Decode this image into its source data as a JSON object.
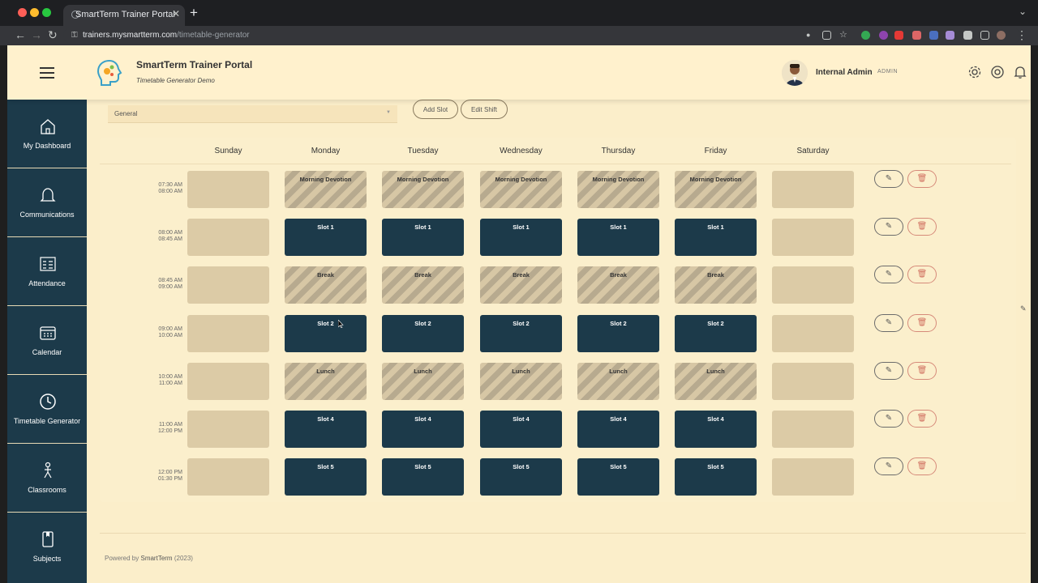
{
  "browser": {
    "tab_title": "SmartTerm Trainer Portal",
    "url_host": "trainers.mysmartterm.com",
    "url_path": "/timetable-generator"
  },
  "header": {
    "title": "SmartTerm Trainer Portal",
    "subtitle": "Timetable Generator Demo",
    "user_name": "Internal Admin",
    "user_role": "ADMIN"
  },
  "sidebar": {
    "items": [
      {
        "label": "My Dashboard",
        "icon": "home-icon"
      },
      {
        "label": "Communications",
        "icon": "bell-icon"
      },
      {
        "label": "Attendance",
        "icon": "list-icon"
      },
      {
        "label": "Calendar",
        "icon": "calendar-icon"
      },
      {
        "label": "Timetable Generator",
        "icon": "clock-icon"
      },
      {
        "label": "Classrooms",
        "icon": "person-icon"
      },
      {
        "label": "Subjects",
        "icon": "book-icon"
      }
    ]
  },
  "toolbar": {
    "shift_selected": "General",
    "add_slot_label": "Add Slot",
    "edit_shift_label": "Edit Shift"
  },
  "timetable": {
    "days": [
      "Sunday",
      "Monday",
      "Tuesday",
      "Wednesday",
      "Thursday",
      "Friday",
      "Saturday"
    ],
    "rows": [
      {
        "start": "07:30 AM",
        "end": "08:00 AM",
        "kind": "break",
        "cells": [
          "",
          "Morning Devotion",
          "Morning Devotion",
          "Morning Devotion",
          "Morning Devotion",
          "Morning Devotion",
          ""
        ]
      },
      {
        "start": "08:00 AM",
        "end": "08:45 AM",
        "kind": "slot",
        "cells": [
          "",
          "Slot 1",
          "Slot 1",
          "Slot 1",
          "Slot 1",
          "Slot 1",
          ""
        ]
      },
      {
        "start": "08:45 AM",
        "end": "09:00 AM",
        "kind": "break",
        "cells": [
          "",
          "Break",
          "Break",
          "Break",
          "Break",
          "Break",
          ""
        ]
      },
      {
        "start": "09:00 AM",
        "end": "10:00 AM",
        "kind": "slot",
        "cells": [
          "",
          "Slot 2",
          "Slot 2",
          "Slot 2",
          "Slot 2",
          "Slot 2",
          ""
        ]
      },
      {
        "start": "10:00 AM",
        "end": "11:00 AM",
        "kind": "break",
        "cells": [
          "",
          "Lunch",
          "Lunch",
          "Lunch",
          "Lunch",
          "Lunch",
          ""
        ]
      },
      {
        "start": "11:00 AM",
        "end": "12:00 PM",
        "kind": "slot",
        "cells": [
          "",
          "Slot 4",
          "Slot 4",
          "Slot 4",
          "Slot 4",
          "Slot 4",
          ""
        ]
      },
      {
        "start": "12:00 PM",
        "end": "01:30 PM",
        "kind": "slot",
        "cells": [
          "",
          "Slot 5",
          "Slot 5",
          "Slot 5",
          "Slot 5",
          "Slot 5",
          ""
        ]
      }
    ]
  },
  "footer": {
    "prefix": "Powered by",
    "brand": "SmartTerm",
    "year": "(2023)"
  },
  "colors": {
    "sidebar": "#1c3a4a",
    "background": "#fbeeca",
    "slot": "#1c3a4a",
    "delete_accent": "#d07060"
  }
}
